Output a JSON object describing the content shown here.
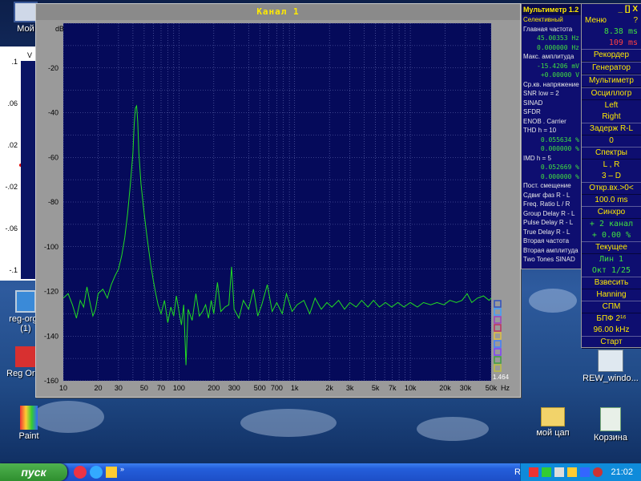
{
  "desktop": {
    "icons": [
      {
        "label": "Мой"
      },
      {
        "label": "reg-orga"
      },
      {
        "label": "(1)"
      },
      {
        "label": "Reg Orga"
      },
      {
        "label": "Paint"
      },
      {
        "label": "REW_windo..."
      },
      {
        "label": "мой цап"
      },
      {
        "label": "Корзина"
      }
    ]
  },
  "background_window": {
    "ticks": [
      ".1",
      "V",
      ".06",
      ".02",
      "-.02",
      "-.06",
      "-.1"
    ]
  },
  "spectrum_window": {
    "title": "Канал 1",
    "unit_label": "dB",
    "corner_value": "1.464",
    "freq_unit": "Hz"
  },
  "chart_data": {
    "type": "line",
    "title": "Канал 1",
    "xlabel": "Hz",
    "ylabel": "dB",
    "xscale": "log",
    "xlim": [
      10,
      50000
    ],
    "ylim": [
      -160,
      0
    ],
    "grid": true,
    "y_ticks": [
      -20,
      -40,
      -60,
      -80,
      -100,
      -120,
      -140,
      -160
    ],
    "x_ticks": [
      {
        "v": 10,
        "l": "10"
      },
      {
        "v": 20,
        "l": "20"
      },
      {
        "v": 30,
        "l": "30"
      },
      {
        "v": 50,
        "l": "50"
      },
      {
        "v": 70,
        "l": "70"
      },
      {
        "v": 100,
        "l": "100"
      },
      {
        "v": 200,
        "l": "200"
      },
      {
        "v": 300,
        "l": "300"
      },
      {
        "v": 500,
        "l": "500"
      },
      {
        "v": 700,
        "l": "700"
      },
      {
        "v": 1000,
        "l": "1k"
      },
      {
        "v": 2000,
        "l": "2k"
      },
      {
        "v": 3000,
        "l": "3k"
      },
      {
        "v": 5000,
        "l": "5k"
      },
      {
        "v": 7000,
        "l": "7k"
      },
      {
        "v": 10000,
        "l": "10k"
      },
      {
        "v": 20000,
        "l": "20k"
      },
      {
        "v": 30000,
        "l": "30k"
      },
      {
        "v": 50000,
        "l": "50k"
      }
    ],
    "series": [
      {
        "color": "#22dd22",
        "points": [
          [
            10,
            -123
          ],
          [
            11,
            -121
          ],
          [
            12,
            -126
          ],
          [
            13,
            -132
          ],
          [
            14,
            -124
          ],
          [
            15,
            -127
          ],
          [
            16,
            -118
          ],
          [
            17,
            -125
          ],
          [
            18,
            -131
          ],
          [
            19,
            -128
          ],
          [
            20,
            -121
          ],
          [
            22,
            -119
          ],
          [
            24,
            -123
          ],
          [
            26,
            -117
          ],
          [
            28,
            -113
          ],
          [
            30,
            -110
          ],
          [
            32,
            -104
          ],
          [
            34,
            -96
          ],
          [
            36,
            -85
          ],
          [
            38,
            -72
          ],
          [
            40,
            -58
          ],
          [
            41,
            -45
          ],
          [
            42,
            -38
          ],
          [
            43,
            -37
          ],
          [
            44,
            -44
          ],
          [
            45,
            -58
          ],
          [
            47,
            -72
          ],
          [
            50,
            -85
          ],
          [
            53,
            -96
          ],
          [
            57,
            -108
          ],
          [
            60,
            -115
          ],
          [
            63,
            -121
          ],
          [
            66,
            -126
          ],
          [
            70,
            -130
          ],
          [
            75,
            -124
          ],
          [
            80,
            -134
          ],
          [
            85,
            -127
          ],
          [
            90,
            -131
          ],
          [
            95,
            -122
          ],
          [
            100,
            -129
          ],
          [
            105,
            -135
          ],
          [
            110,
            -126
          ],
          [
            115,
            -153
          ],
          [
            120,
            -128
          ],
          [
            130,
            -133
          ],
          [
            140,
            -121
          ],
          [
            150,
            -131
          ],
          [
            160,
            -129
          ],
          [
            170,
            -126
          ],
          [
            180,
            -132
          ],
          [
            190,
            -124
          ],
          [
            200,
            -130
          ],
          [
            215,
            -116
          ],
          [
            230,
            -129
          ],
          [
            250,
            -127
          ],
          [
            270,
            -126
          ],
          [
            285,
            -109
          ],
          [
            300,
            -128
          ],
          [
            330,
            -132
          ],
          [
            360,
            -124
          ],
          [
            400,
            -128
          ],
          [
            440,
            -119
          ],
          [
            480,
            -131
          ],
          [
            520,
            -126
          ],
          [
            580,
            -117
          ],
          [
            640,
            -129
          ],
          [
            700,
            -125
          ],
          [
            780,
            -130
          ],
          [
            850,
            -121
          ],
          [
            950,
            -129
          ],
          [
            1050,
            -126
          ],
          [
            1200,
            -124
          ],
          [
            1350,
            -130
          ],
          [
            1500,
            -123
          ],
          [
            1700,
            -128
          ],
          [
            1900,
            -125
          ],
          [
            2100,
            -127
          ],
          [
            2400,
            -124
          ],
          [
            2700,
            -128
          ],
          [
            3000,
            -125
          ],
          [
            3400,
            -127
          ],
          [
            3800,
            -124
          ],
          [
            4300,
            -127
          ],
          [
            4800,
            -124
          ],
          [
            5400,
            -127
          ],
          [
            6100,
            -125
          ],
          [
            6900,
            -127
          ],
          [
            7800,
            -125
          ],
          [
            8800,
            -127
          ],
          [
            10000,
            -125
          ],
          [
            11500,
            -127
          ],
          [
            13000,
            -125
          ],
          [
            15000,
            -126
          ],
          [
            17000,
            -125
          ],
          [
            19500,
            -126
          ],
          [
            22000,
            -124
          ],
          [
            25000,
            -125
          ],
          [
            28000,
            -124
          ],
          [
            31000,
            -121
          ],
          [
            34000,
            -125
          ],
          [
            38000,
            -123
          ],
          [
            43000,
            -122
          ],
          [
            48000,
            -124
          ],
          [
            50000,
            -123
          ]
        ]
      }
    ]
  },
  "multimeter": {
    "title": "Мультиметр 1.2",
    "rows": [
      {
        "text": "Селективный",
        "cls": "y"
      },
      {
        "text": "Главная частота",
        "cls": ""
      },
      {
        "text": "45.00353  Hz",
        "cls": "g"
      },
      {
        "text": "0.000000  Hz",
        "cls": "g"
      },
      {
        "text": "Макс. амплитуда",
        "cls": ""
      },
      {
        "text": "-15.4206 mV",
        "cls": "g"
      },
      {
        "text": "+0.00000  V",
        "cls": "g"
      },
      {
        "text": "Ср.кв. напряжение",
        "cls": ""
      },
      {
        "text": "SNR     low = 2",
        "cls": ""
      },
      {
        "text": "SINAD",
        "cls": ""
      },
      {
        "text": "SFDR",
        "cls": ""
      },
      {
        "text": "ENOB . Carrier",
        "cls": ""
      },
      {
        "text": "THD      h = 10",
        "cls": ""
      },
      {
        "text": "0.055634 %",
        "cls": "g"
      },
      {
        "text": "0.000000 %",
        "cls": "g"
      },
      {
        "text": "IMD      h =  5",
        "cls": ""
      },
      {
        "text": "0.052669 %",
        "cls": "g"
      },
      {
        "text": "0.000000 %",
        "cls": "g"
      },
      {
        "text": "Пост. смещение",
        "cls": ""
      },
      {
        "text": "Сдвиг фаз R - L",
        "cls": ""
      },
      {
        "text": "Freq. Ratio  L / R",
        "cls": ""
      },
      {
        "text": "Group Delay R - L",
        "cls": ""
      },
      {
        "text": "Pulse Delay R - L",
        "cls": ""
      },
      {
        "text": "True Delay R - L",
        "cls": ""
      },
      {
        "text": "Вторая частота",
        "cls": ""
      },
      {
        "text": "Вторая амплитуда",
        "cls": ""
      },
      {
        "text": "Two Tones SINAD",
        "cls": ""
      }
    ]
  },
  "control_panel": {
    "header": "_ [] X",
    "menu": "Меню",
    "help": "?",
    "t1": "8.38 ms",
    "t2": "109 ms",
    "rows": [
      {
        "text": "Рекордер",
        "cls": "y btn"
      },
      {
        "text": "Генератор",
        "cls": "y btn"
      },
      {
        "text": "Мультиметр",
        "cls": "y btn"
      },
      {
        "text": "Осциллогр",
        "cls": "y btn"
      },
      {
        "text": "Left",
        "cls": "y"
      },
      {
        "text": "Right",
        "cls": "y"
      },
      {
        "text": "Задерж  R-L",
        "cls": "y btn"
      },
      {
        "text": "0",
        "cls": "y"
      },
      {
        "text": "Спектры",
        "cls": "y btn"
      },
      {
        "text": "L , R",
        "cls": "y"
      },
      {
        "text": "3 – D",
        "cls": "y"
      },
      {
        "text": "Откр.вх.>0<",
        "cls": "y btn"
      },
      {
        "text": "100.0 ms",
        "cls": "y"
      },
      {
        "text": "Синхро",
        "cls": "y btn"
      },
      {
        "text": "+ 2 канал",
        "cls": "g"
      },
      {
        "text": "+ 0.00 %",
        "cls": "g"
      },
      {
        "text": "Текущее",
        "cls": "y btn"
      },
      {
        "text": "Лин      1",
        "cls": "g"
      },
      {
        "text": "Окт  1/25",
        "cls": "g"
      },
      {
        "text": "Взвесить",
        "cls": "y btn"
      },
      {
        "text": "Hanning",
        "cls": "y"
      },
      {
        "text": "СПМ",
        "cls": "y btn"
      },
      {
        "text": "БПФ  2¹⁶",
        "cls": "y"
      },
      {
        "text": "96.00 kHz",
        "cls": "y"
      },
      {
        "text": "Старт",
        "cls": "y btn"
      }
    ]
  },
  "taskbar": {
    "start_label": "пуск",
    "lang": "RL",
    "clock": "21:02"
  },
  "colors": {
    "plot_bg": "#050a5a",
    "grid": "#6a72b8",
    "trace": "#22dd22",
    "accent_yellow": "#ffea00"
  }
}
